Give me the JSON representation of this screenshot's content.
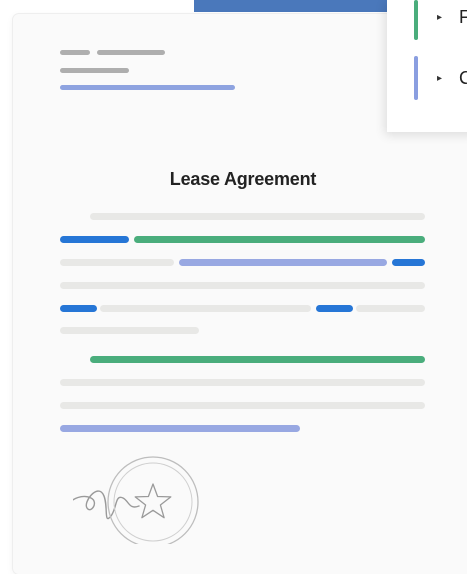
{
  "document": {
    "title": "Lease Agreement",
    "colors": {
      "highlight_blue": "#2676d6",
      "highlight_green": "#4aad7c",
      "highlight_lavender": "#98a8e2",
      "placeholder_gray": "#e8e8e6"
    },
    "signature_icon": "signature-scribble",
    "seal_icon": "star-seal"
  },
  "popover": {
    "items": [
      {
        "label": "F",
        "accent": "#4aad7c",
        "caret_icon": "caret-right-icon"
      },
      {
        "label": "C",
        "accent": "#8a9ee0",
        "caret_icon": "caret-right-icon"
      }
    ]
  }
}
